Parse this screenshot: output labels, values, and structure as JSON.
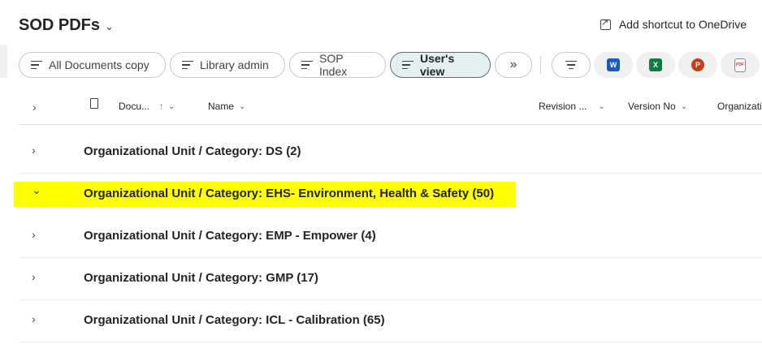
{
  "library": {
    "title": "SOD PDFs",
    "shortcut_label": "Add shortcut to OneDrive"
  },
  "views": [
    {
      "label": "All Documents copy"
    },
    {
      "label": "Library admin"
    },
    {
      "label": "SOP Index"
    },
    {
      "label": "User's view",
      "active": true
    }
  ],
  "apps": [
    {
      "name": "word-icon",
      "letter": "W",
      "color": "#185abd"
    },
    {
      "name": "excel-icon",
      "letter": "X",
      "color": "#107c41"
    },
    {
      "name": "powerpoint-icon",
      "letter": "P",
      "color": "#c43e1c"
    },
    {
      "name": "pdf-icon",
      "letter": "PDF",
      "color": "#d13438"
    }
  ],
  "columns": {
    "document": "Docu...",
    "name": "Name",
    "revision": "Revision ...",
    "version": "Version No",
    "org": "Organizati"
  },
  "groups": [
    {
      "label": "Organizational Unit / Category: DS (2)",
      "expanded": false
    },
    {
      "label": "Organizational Unit / Category: EHS- Environment, Health & Safety (50)",
      "expanded": true
    },
    {
      "label": "Organizational Unit / Category: EMP - Empower (4)",
      "expanded": false
    },
    {
      "label": "Organizational Unit / Category: GMP (17)",
      "expanded": false
    },
    {
      "label": "Organizational Unit / Category: ICL - Calibration (65)",
      "expanded": false
    }
  ]
}
